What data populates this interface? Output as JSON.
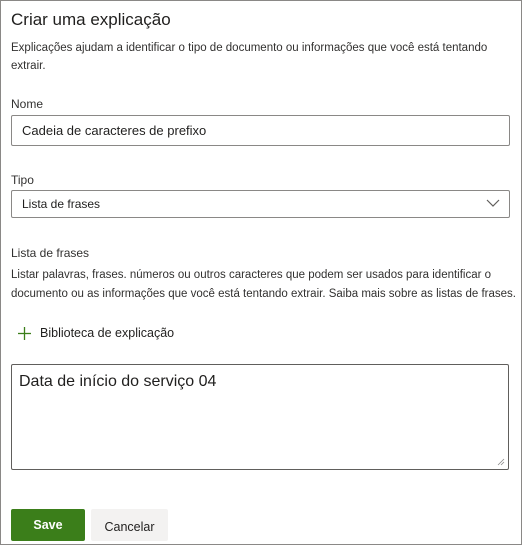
{
  "panel": {
    "title": "Criar uma explicação",
    "description": "Explicações ajudam a identificar o tipo de documento ou informações que você está tentando extrair."
  },
  "name_field": {
    "label": "Nome",
    "value": "Cadeia de caracteres de prefixo"
  },
  "type_field": {
    "label": "Tipo",
    "selected": "Lista de frases",
    "icon": "chevron-down-icon"
  },
  "phrase_list": {
    "label": "Lista de frases",
    "help_text": "Listar palavras, frases. números ou outros caracteres que podem ser usados para identificar o documento ou as informações que você está tentando extrair. Saiba mais sobre as listas de frases.",
    "library_link_label": "Biblioteca de explicação",
    "library_icon": "plus-icon",
    "value": "Data de início do serviço 04"
  },
  "actions": {
    "save_label": "Save",
    "cancel_label": "Cancelar"
  },
  "colors": {
    "primary": "#3b7e1a",
    "border": "#8a8886",
    "text": "#323130"
  }
}
